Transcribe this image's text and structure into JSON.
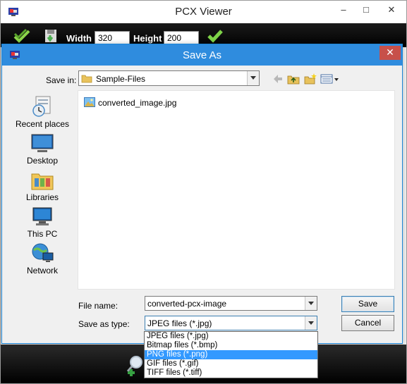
{
  "main_window": {
    "title": "PCX Viewer",
    "controls": {
      "minimize": "–",
      "maximize": "□",
      "close": "✕"
    },
    "toolbar": {
      "width_label": "Width",
      "width_value": "320",
      "height_label": "Height",
      "height_value": "200",
      "icons": [
        "check-all-icon",
        "save-icon",
        "apply-check-icon"
      ]
    },
    "bottom_icons": [
      "zoom-in-icon"
    ]
  },
  "dialog": {
    "title": "Save As",
    "close_glyph": "✕",
    "save_in": {
      "label": "Save in:",
      "value": "Sample-Files"
    },
    "nav_tools": [
      "back-arrow-icon",
      "up-folder-icon",
      "new-folder-icon",
      "view-menu-icon"
    ],
    "places": [
      {
        "label": "Recent places",
        "icon": "recent-places-icon"
      },
      {
        "label": "Desktop",
        "icon": "desktop-icon"
      },
      {
        "label": "Libraries",
        "icon": "libraries-icon"
      },
      {
        "label": "This PC",
        "icon": "this-pc-icon"
      },
      {
        "label": "Network",
        "icon": "network-icon"
      }
    ],
    "files": [
      {
        "name": "converted_image.jpg",
        "icon": "image-file-icon"
      }
    ],
    "file_name": {
      "label": "File name:",
      "value": "converted-pcx-image"
    },
    "save_as_type": {
      "label": "Save as type:",
      "value": "JPEG files (*.jpg)",
      "options": [
        "JPEG files (*.jpg)",
        "Bitmap files (*.bmp)",
        "PNG files (*.png)",
        "GIF files (*.gif)",
        "TIFF files (*.tiff)"
      ],
      "highlighted_index": 2
    },
    "buttons": {
      "save": "Save",
      "cancel": "Cancel"
    }
  },
  "colors": {
    "dialog_titlebar": "#2f8cde",
    "dialog_close": "#c7504a",
    "toolbar_bg": "#000000",
    "selection": "#3399ff"
  }
}
